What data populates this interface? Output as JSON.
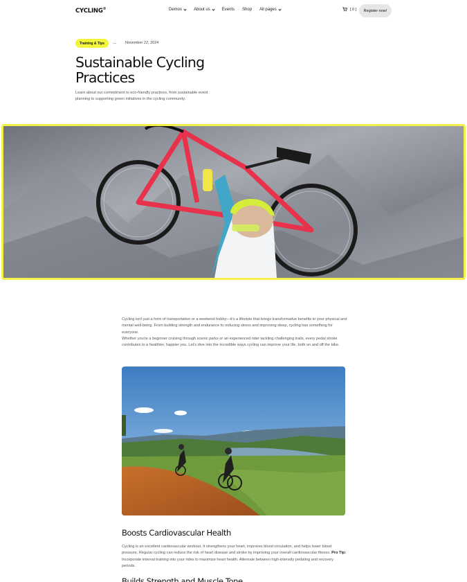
{
  "header": {
    "logo": "CYCLING",
    "logo_mark": "®",
    "nav": [
      {
        "label": "Demos",
        "has_dropdown": true
      },
      {
        "label": "About us",
        "has_dropdown": true
      },
      {
        "label": "Events",
        "has_dropdown": false
      },
      {
        "label": "Shop",
        "has_dropdown": false
      },
      {
        "label": "All pages",
        "has_dropdown": true
      }
    ],
    "cart_count": "[ 0 ]",
    "cart_icon": "cart-icon",
    "register_label": "Register now!"
  },
  "post": {
    "category": "Training & Tips",
    "date": "November 22, 2024",
    "title": "Sustainable Cycling Practices",
    "subtitle": "Learn about our commitment to eco-friendly practices, from sustainable event planning to supporting green initiatives in the cycling community."
  },
  "article": {
    "intro_1": "Cycling isn't just a form of transportation or a weekend hobby—it's a lifestyle that brings transformative benefits to your physical and mental well-being. From building strength and endurance to reducing stress and improving sleep, cycling has something for everyone.",
    "intro_2": "Whether you're a beginner cruising through scenic parks or an experienced rider tackling challenging trails, every pedal stroke contributes to a healthier, happier you. Let's dive into the incredible ways cycling can improve your life, both on and off the bike.",
    "section_1": {
      "heading": "Boosts Cardiovascular Health",
      "text": "Cycling is an excellent cardiovascular workout. It strengthens your heart, improves blood circulation, and helps lower blood pressure. Regular cycling can reduce the risk of heart disease and stroke by improving your overall cardiovascular fitness.",
      "tip_label": "Pro Tip:",
      "tip_text": "Incorporate interval training into your rides to maximize heart health. Alternate between high-intensity pedaling and recovery periods."
    },
    "section_2": {
      "heading": "Builds Strength and Muscle Tone"
    }
  },
  "colors": {
    "accent": "#f2f53b",
    "button_bg": "#e6e6e6",
    "text": "#111111",
    "muted": "#555555"
  }
}
